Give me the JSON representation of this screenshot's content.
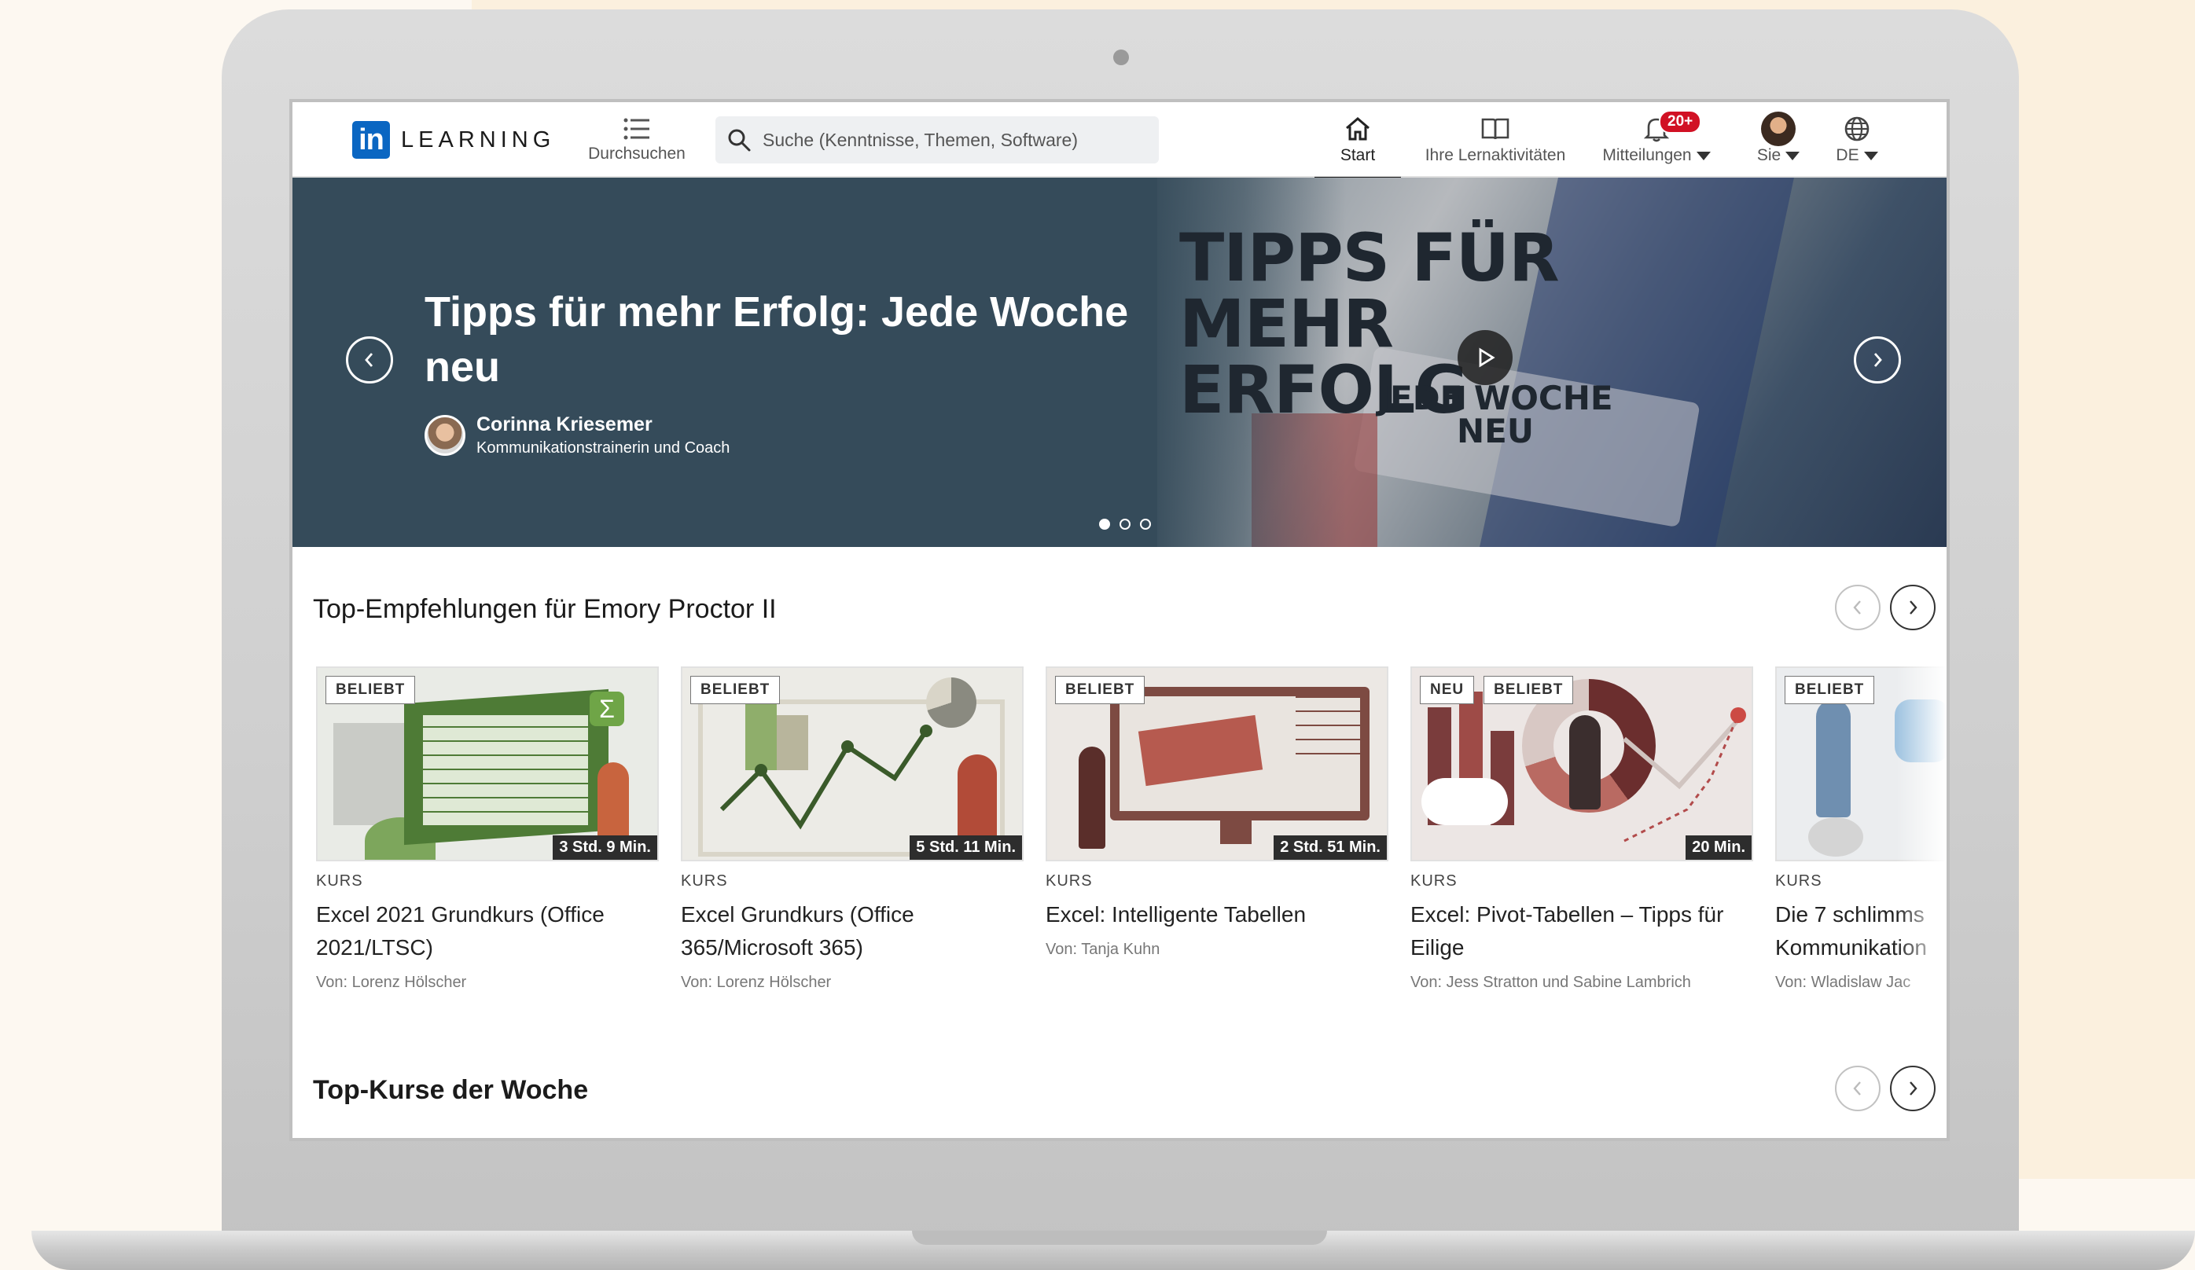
{
  "app": {
    "logo_mark": "in",
    "logo_text": "LEARNING"
  },
  "nav": {
    "browse_label": "Durchsuchen",
    "search_placeholder": "Suche (Kenntnisse, Themen, Software)",
    "start_label": "Start",
    "activities_label": "Ihre Lernaktivitäten",
    "notifications_label": "Mitteilungen",
    "notifications_badge": "20+",
    "me_label": "Sie",
    "language_label": "DE"
  },
  "hero": {
    "title": "Tipps für mehr Erfolg: Jede Woche neu",
    "author_name": "Corinna Kriesemer",
    "author_role": "Kommunikationstrainerin und Coach",
    "image_title": "TIPPS FÜR MEHR ERFOLG",
    "image_sub": "JEDE WOCHE NEU",
    "slide_count": 3,
    "active_slide": 1
  },
  "recommendations": {
    "title": "Top-Empfehlungen für Emory Proctor II",
    "cards": [
      {
        "badges": [
          "BELIEBT"
        ],
        "duration": "3 Std. 9 Min.",
        "kind": "KURS",
        "title": "Excel 2021 Grundkurs (Office 2021/LTSC)",
        "author": "Von: Lorenz Hölscher"
      },
      {
        "badges": [
          "BELIEBT"
        ],
        "duration": "5 Std. 11 Min.",
        "kind": "KURS",
        "title": "Excel Grundkurs (Office 365/Microsoft 365)",
        "author": "Von: Lorenz Hölscher"
      },
      {
        "badges": [
          "BELIEBT"
        ],
        "duration": "2 Std. 51 Min.",
        "kind": "KURS",
        "title": "Excel: Intelligente Tabellen",
        "author": "Von: Tanja Kuhn"
      },
      {
        "badges": [
          "NEU",
          "BELIEBT"
        ],
        "duration": "20 Min.",
        "kind": "KURS",
        "title": "Excel: Pivot-Tabellen – Tipps für Eilige",
        "author": "Von: Jess Stratton und Sabine Lambrich"
      },
      {
        "badges": [
          "BELIEBT"
        ],
        "duration": "",
        "kind": "KURS",
        "title": "Die 7 schlimms Kommunikation",
        "author": "Von: Wladislaw Jac"
      }
    ]
  },
  "weekly": {
    "title": "Top-Kurse der Woche"
  },
  "colors": {
    "brand": "#0a66c2",
    "hero_bg": "#354b5a",
    "badge_red": "#d11124"
  }
}
